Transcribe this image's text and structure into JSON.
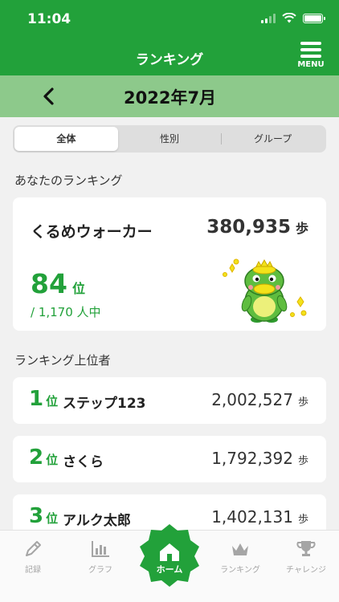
{
  "status_bar": {
    "time": "11:04"
  },
  "header": {
    "title": "ランキング",
    "menu_label": "MENU"
  },
  "month_bar": {
    "label": "2022年7月"
  },
  "segments": [
    {
      "label": "全体",
      "active": true
    },
    {
      "label": "性別",
      "active": false
    },
    {
      "label": "グループ",
      "active": false
    }
  ],
  "my_ranking": {
    "section_title": "あなたのランキング",
    "group": "くるめウォーカー",
    "steps": "380,935",
    "steps_unit": "歩",
    "rank": "84",
    "rank_unit": "位",
    "total": "/ 1,170 人中"
  },
  "top_ranking": {
    "section_title": "ランキング上位者",
    "items": [
      {
        "rank": "1",
        "rank_unit": "位",
        "name": "ステップ123",
        "steps": "2,002,527",
        "steps_unit": "歩"
      },
      {
        "rank": "2",
        "rank_unit": "位",
        "name": "さくら",
        "steps": "1,792,392",
        "steps_unit": "歩"
      },
      {
        "rank": "3",
        "rank_unit": "位",
        "name": "アルク太郎",
        "steps": "1,402,131",
        "steps_unit": "歩"
      }
    ]
  },
  "tabbar": {
    "record": "記録",
    "graph": "グラフ",
    "home": "ホーム",
    "ranking": "ランキング",
    "challenge": "チャレンジ"
  },
  "colors": {
    "accent": "#22a13a",
    "month_bar": "#8dc98b",
    "mascot_yellow": "#f2e21a"
  }
}
